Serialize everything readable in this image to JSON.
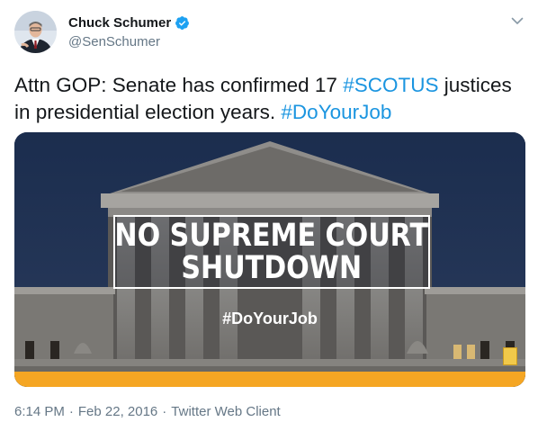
{
  "author": {
    "display_name": "Chuck Schumer",
    "handle": "@SenSchumer",
    "verified": true
  },
  "tweet": {
    "text_1": "Attn GOP: Senate has confirmed 17 ",
    "hashtag_1": "#SCOTUS",
    "text_2": " justices in presidential election years. ",
    "hashtag_2": "#DoYourJob"
  },
  "media": {
    "banner_line_1": "NO SUPREME COURT",
    "banner_line_2": "SHUTDOWN",
    "hashtag": "#DoYourJob"
  },
  "meta": {
    "time": "6:14 PM",
    "sep_1": "·",
    "date": "Feb 22, 2016",
    "sep_2": "·",
    "source": "Twitter Web Client"
  },
  "colors": {
    "link": "#1b95e0",
    "muted": "#657786",
    "verified": "#1da1f2",
    "accent_bar": "#f5a623"
  }
}
